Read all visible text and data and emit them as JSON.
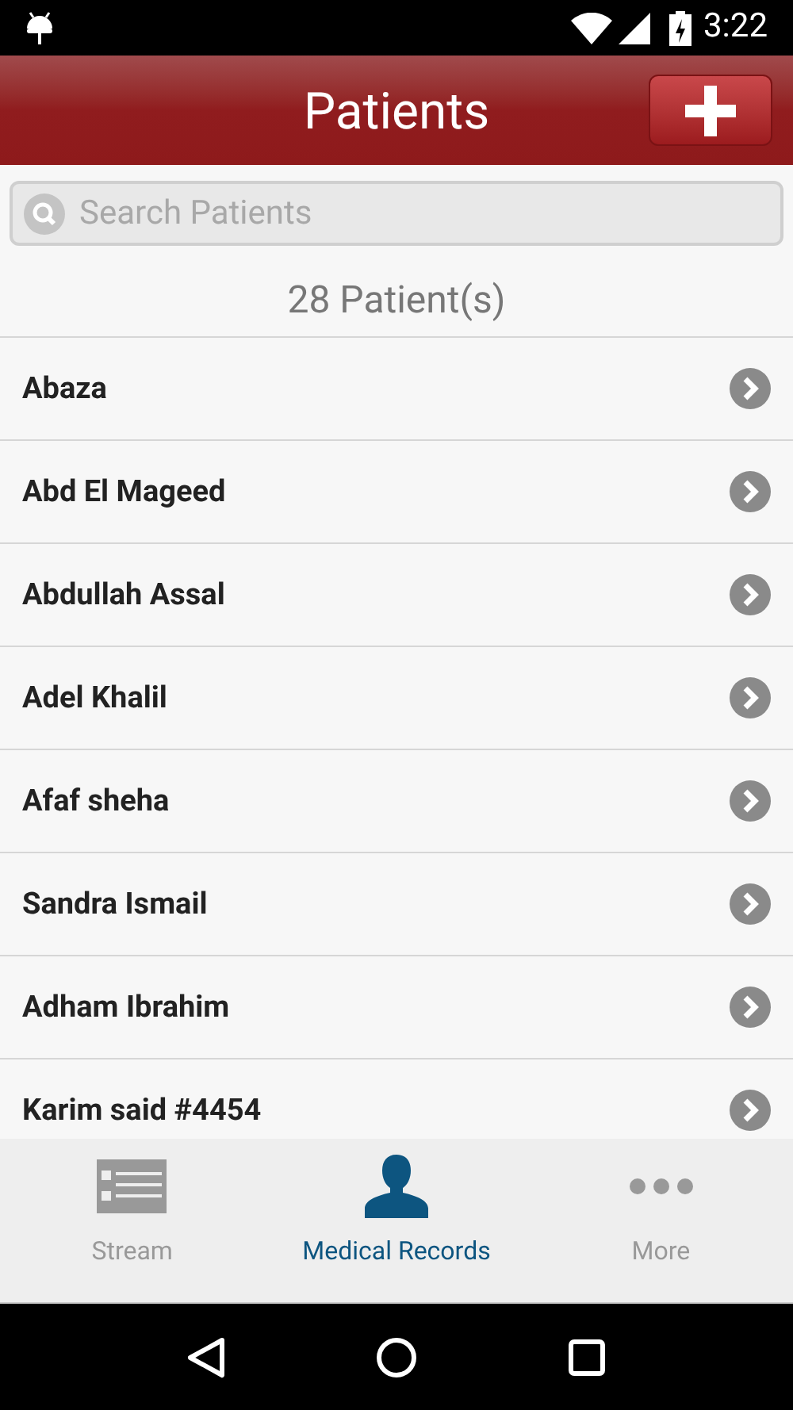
{
  "status_bar": {
    "time": "3:22"
  },
  "header": {
    "title": "Patients"
  },
  "search": {
    "placeholder": "Search Patients"
  },
  "count": "28 Patient(s)",
  "patients": [
    {
      "name": "Abaza"
    },
    {
      "name": "Abd El Mageed"
    },
    {
      "name": "Abdullah Assal"
    },
    {
      "name": "Adel Khalil"
    },
    {
      "name": "Afaf sheha"
    },
    {
      "name": "Sandra Ismail"
    },
    {
      "name": "Adham Ibrahim"
    },
    {
      "name": "Karim said #4454"
    }
  ],
  "tabs": [
    {
      "label": "Stream",
      "kind": "list",
      "selected": false
    },
    {
      "label": "Medical Records",
      "kind": "person",
      "selected": true
    },
    {
      "label": "More",
      "kind": "dots",
      "selected": false
    }
  ]
}
